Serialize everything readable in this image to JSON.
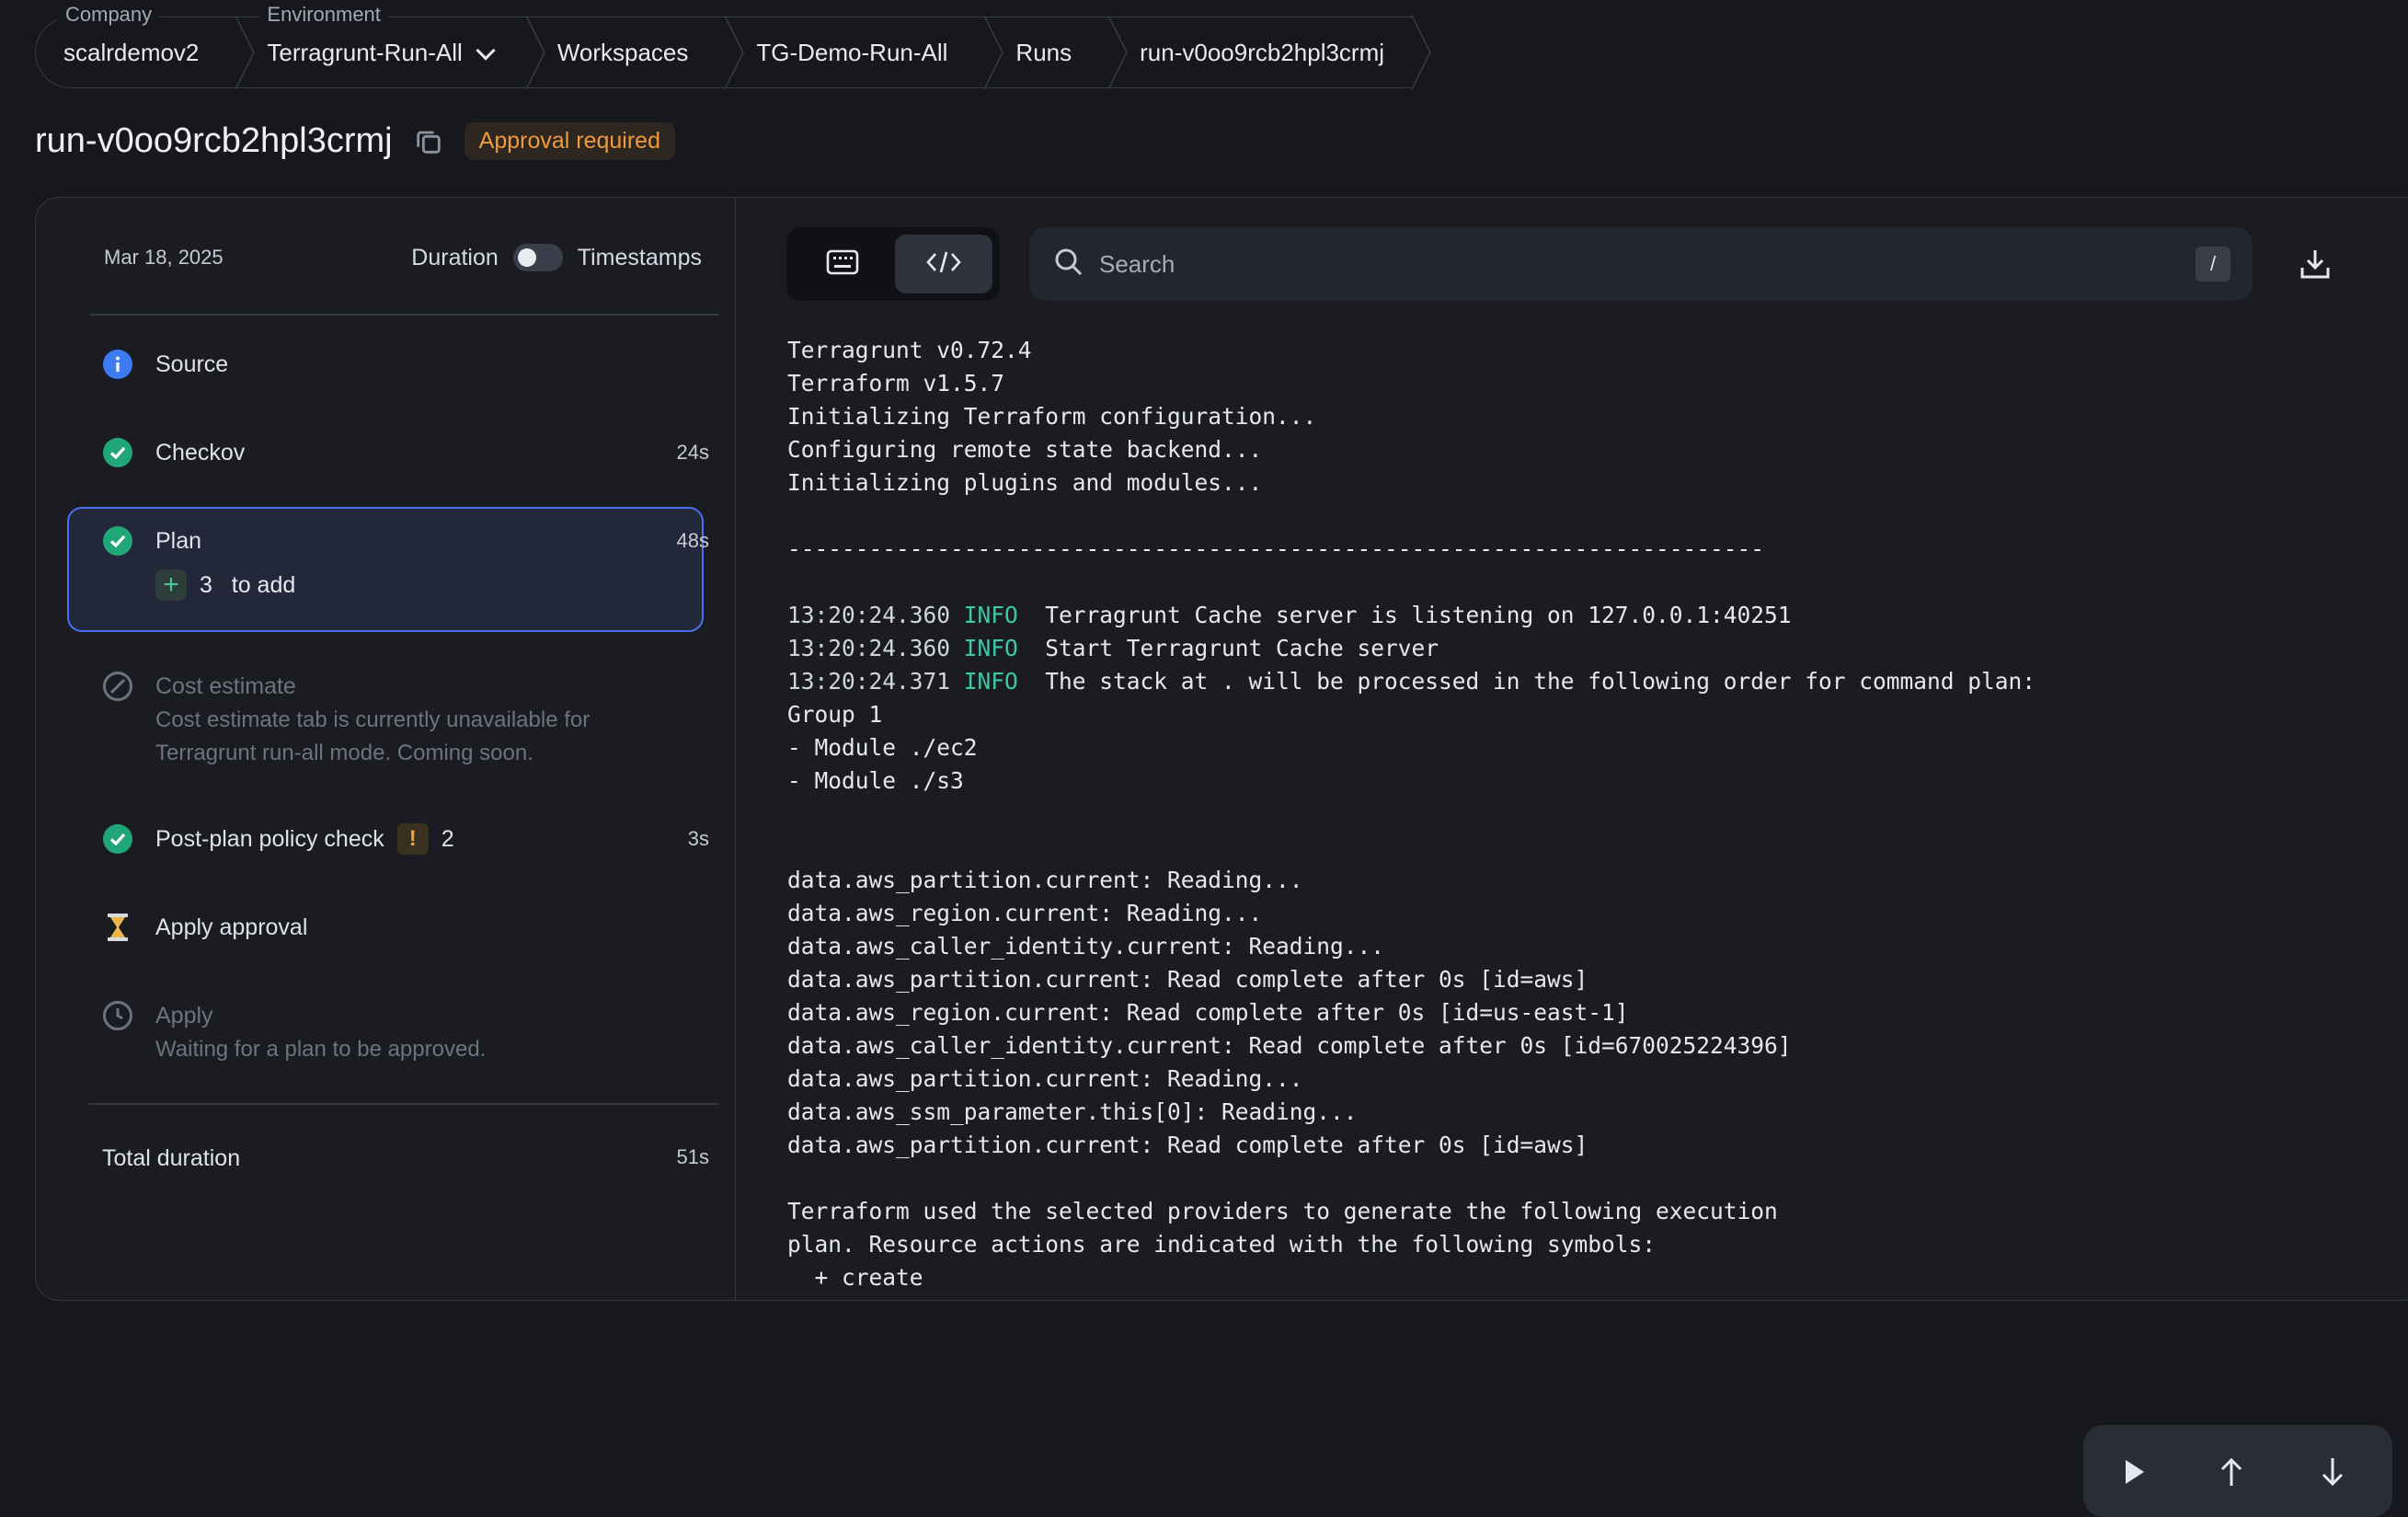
{
  "breadcrumb": {
    "company_caption": "Company",
    "company": "scalrdemov2",
    "environment_caption": "Environment",
    "environment": "Terragrunt-Run-All",
    "workspaces": "Workspaces",
    "workspace": "TG-Demo-Run-All",
    "runs": "Runs",
    "run": "run-v0oo9rcb2hpl3crmj"
  },
  "run": {
    "id": "run-v0oo9rcb2hpl3crmj",
    "status_badge": "Approval required"
  },
  "sidebar": {
    "date": "Mar 18, 2025",
    "duration_label": "Duration",
    "timestamps_label": "Timestamps",
    "steps": [
      {
        "name": "Source",
        "time": "",
        "status": "info"
      },
      {
        "name": "Checkov",
        "time": "24s",
        "status": "success"
      },
      {
        "name": "Plan",
        "time": "48s",
        "status": "success",
        "add_count": "3",
        "add_label": "to add"
      },
      {
        "name": "Cost estimate",
        "time": "",
        "status": "disabled",
        "note": "Cost estimate tab is currently unavailable for Terragrunt run-all mode. Coming soon."
      },
      {
        "name": "Post-plan policy check",
        "time": "3s",
        "status": "success",
        "warnings": "2"
      },
      {
        "name": "Apply approval",
        "time": "",
        "status": "pending"
      },
      {
        "name": "Apply",
        "time": "",
        "status": "waiting",
        "note": "Waiting for a plan to be approved."
      }
    ],
    "total_label": "Total duration",
    "total_value": "51s"
  },
  "log_toolbar": {
    "search_placeholder": "Search",
    "shortcut": "/"
  },
  "log_lines": [
    "Terragrunt v0.72.4",
    "Terraform v1.5.7",
    "Initializing Terraform configuration...",
    "Configuring remote state backend...",
    "Initializing plugins and modules...",
    "",
    "------------------------------------------------------------------------",
    "",
    {
      "ts": "13:20:24.360",
      "lvl": "INFO",
      "msg": "  Terragrunt Cache server is listening on 127.0.0.1:40251"
    },
    {
      "ts": "13:20:24.360",
      "lvl": "INFO",
      "msg": "  Start Terragrunt Cache server"
    },
    {
      "ts": "13:20:24.371",
      "lvl": "INFO",
      "msg": "  The stack at . will be processed in the following order for command plan:"
    },
    "Group 1",
    "- Module ./ec2",
    "- Module ./s3",
    "",
    "",
    "data.aws_partition.current: Reading...",
    "data.aws_region.current: Reading...",
    "data.aws_caller_identity.current: Reading...",
    "data.aws_partition.current: Read complete after 0s [id=aws]",
    "data.aws_region.current: Read complete after 0s [id=us-east-1]",
    "data.aws_caller_identity.current: Read complete after 0s [id=670025224396]",
    "data.aws_partition.current: Reading...",
    "data.aws_ssm_parameter.this[0]: Reading...",
    "data.aws_partition.current: Read complete after 0s [id=aws]",
    "",
    "Terraform used the selected providers to generate the following execution",
    "plan. Resource actions are indicated with the following symbols:",
    "  + create"
  ]
}
